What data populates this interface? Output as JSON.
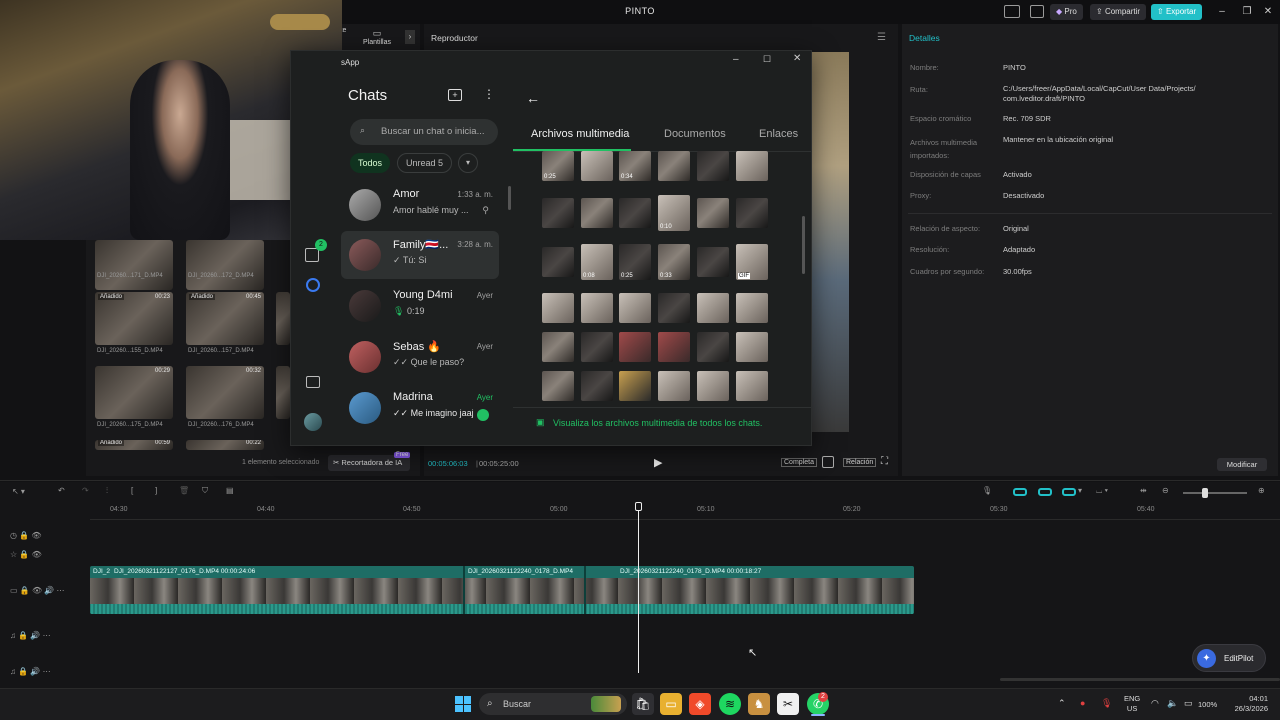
{
  "app": {
    "title": "PINTO",
    "pro_label": "Pro",
    "share_label": "Compartir",
    "export_label": "Exportar"
  },
  "media": {
    "tabs": [
      {
        "label": "Plantillas"
      }
    ],
    "tab_fragment": "ste",
    "items": [
      {
        "name": "DJI_20260...171_D.MP4",
        "tag": "",
        "dur": ""
      },
      {
        "name": "DJI_20260...172_D.MP4",
        "tag": "",
        "dur": ""
      },
      {
        "name": "DJI_20260...155_D.MP4",
        "tag": "Añadido",
        "dur": "00:23"
      },
      {
        "name": "DJI_20260...157_D.MP4",
        "tag": "Añadido",
        "dur": "00:45"
      },
      {
        "name": "DJI_20260...175_D.MP4",
        "tag": "",
        "dur": "00:29"
      },
      {
        "name": "DJI_20260...176_D.MP4",
        "tag": "",
        "dur": "00:32"
      },
      {
        "name": "",
        "tag": "Añadido",
        "dur": "00:59"
      },
      {
        "name": "",
        "tag": "",
        "dur": "00:22"
      }
    ],
    "selected_text": "1 elemento seleccionado",
    "ai_cutout": "Recortadora de IA",
    "free_badge": "Free",
    "badge_count": "2"
  },
  "player": {
    "title": "Reproductor",
    "current": "00:05:06:03",
    "total": "00:05:25:00",
    "full_label": "Completa",
    "ratio_label": "Relación"
  },
  "details": {
    "title": "Detalles",
    "rows": [
      {
        "label": "Nombre:",
        "value": "PINTO"
      },
      {
        "label": "Ruta:",
        "value": "C:/Users/freer/AppData/Local/CapCut/User Data/Projects/ com.lveditor.draft/PINTO"
      },
      {
        "label": "Espacio cromático",
        "value": "Rec. 709 SDR"
      },
      {
        "label": "Archivos multimedia importados:",
        "value": "Mantener en la ubicación original"
      },
      {
        "label": "Disposición de capas",
        "value": "Activado"
      },
      {
        "label": "Proxy:",
        "value": "Desactivado"
      },
      {
        "label": "Relación de aspecto:",
        "value": "Original"
      },
      {
        "label": "Resolución:",
        "value": "Adaptado"
      },
      {
        "label": "Cuadros por segundo:",
        "value": "30.00fps"
      }
    ],
    "modify_label": "Modificar"
  },
  "whatsapp": {
    "title": "sApp",
    "chats_label": "Chats",
    "search_placeholder": "Buscar un chat o inicia...",
    "filters": [
      "Todos",
      "Unread 5"
    ],
    "chats": [
      {
        "name": "Amor",
        "time": "1:33 a. m.",
        "preview": "Amor hablé muy ...",
        "color": "#8a8a8a"
      },
      {
        "name": "Family🇨🇷...",
        "time": "3:28 a. m.",
        "preview": "✓ Tú: Si",
        "color": "#6a4a4a"
      },
      {
        "name": "Young D4mi",
        "time": "Ayer",
        "preview": "0:19",
        "color": "#3a2a2a"
      },
      {
        "name": "Sebas 🔥",
        "time": "Ayer",
        "preview": "✓✓ Que le paso?",
        "color": "#b04a4a"
      },
      {
        "name": "Madrina",
        "time": "Ayer",
        "preview": "✓✓ Me imagino jaaj",
        "color": "#4a7ab0"
      }
    ],
    "media_tabs": [
      "Archivos multimedia",
      "Documentos",
      "Enlaces"
    ],
    "durations": [
      "0:25",
      "0:34",
      "0:10",
      "0:08",
      "0:25",
      "0:33",
      "GIF"
    ],
    "footer_link": "Visualiza los archivos multimedia de todos los chats.",
    "rail_badge": "2"
  },
  "timeline": {
    "ticks": [
      "04:30",
      "04:40",
      "04:50",
      "05:00",
      "05:10",
      "05:20",
      "05:30",
      "05:40"
    ],
    "clip_labels": [
      "DJI_2",
      "DJI_20260321122127_0176_D.MP4  00:00:24:06",
      "DJI_20260321122240_0178_D.MP4",
      "DJI_20260321122240_0178_D.MP4  00:00:18:27"
    ],
    "editpilot": "EditPilot"
  },
  "taskbar": {
    "search": "Buscar",
    "lang1": "ENG",
    "lang2": "US",
    "battery": "100%",
    "time": "04:01",
    "date": "26/3/2026",
    "whatsapp_badge": "2"
  }
}
